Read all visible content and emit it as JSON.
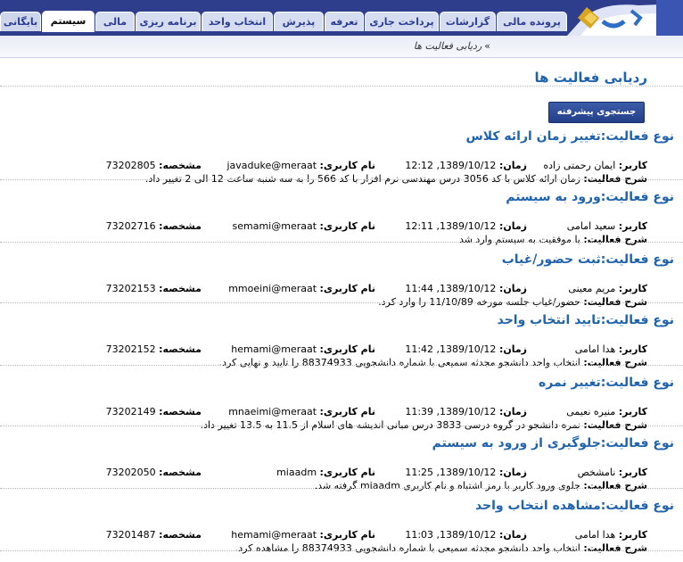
{
  "tabs": [
    {
      "label": "پرونده مالی"
    },
    {
      "label": "گزارشات"
    },
    {
      "label": "پرداخت جاری"
    },
    {
      "label": "تعرفه"
    },
    {
      "label": "پذیرش"
    },
    {
      "label": "انتخاب واحد"
    },
    {
      "label": "برنامه ریزی"
    },
    {
      "label": "مالی"
    },
    {
      "label": "سیستم"
    },
    {
      "label": "بایگانی"
    }
  ],
  "active_tab": "سیستم",
  "breadcrumb": {
    "sep": "»",
    "text": "ردیابی فعالیت ها"
  },
  "page_title": "ردیابی فعالیت ها",
  "advanced_search_label": "جستجوی پیشرفته",
  "labels": {
    "type": "نوع فعالیت:",
    "user": "کاربر:",
    "time": "زمان:",
    "username": "نام کاربری:",
    "id": "مشخصه:",
    "desc": "شرح فعالیت:"
  },
  "activities": [
    {
      "type": "تغییر زمان ارائه کلاس",
      "user": "ایمان رحمتی زاده",
      "time": "1389/10/12, 12:12",
      "username": "javaduke@meraat",
      "id": "73202805",
      "desc": "زمان ارائه کلاس با کد 3056 درس مهندسی نرم افزار با کد 566 را به سه شنبه ساعت 12 الی 2 تغییر داد."
    },
    {
      "type": "ورود به سیستم",
      "user": "سعید امامی",
      "time": "1389/10/12, 12:11",
      "username": "semami@meraat",
      "id": "73202716",
      "desc": "با موفقیت به سیستم وارد شد"
    },
    {
      "type": "ثبت حضور/غیاب",
      "user": "مریم معینی",
      "time": "1389/10/12, 11:44",
      "username": "mmoeini@meraat",
      "id": "73202153",
      "desc": "حضور/غیاب جلسه مورخه 11/10/89 را وارد کرد."
    },
    {
      "type": "تایید انتخاب واحد",
      "user": "هدا امامی",
      "time": "1389/10/12, 11:42",
      "username": "hemami@meraat",
      "id": "73202152",
      "desc": "انتخاب واحد دانشجو مجدثه سمیعی با شماره دانشجویی 88374933 را تایید و نهایی کرد."
    },
    {
      "type": "تغییر نمره",
      "user": "منیره نعیمی",
      "time": "1389/10/12, 11:39",
      "username": "mnaeimi@meraat",
      "id": "73202149",
      "desc": "نمره دانشجو در گروه درسی 3833 درس مبانی اندیشه های اسلام از 11.5 به 13.5 تغییر داد."
    },
    {
      "type": "جلوگیری از ورود به سیستم",
      "user": "نامشخص",
      "time": "1389/10/12, 11:25",
      "username": "miaadm",
      "id": "73202050",
      "desc": "جلوی ورود کاربر با رمز اشتباه و نام کاربری miaadm گرفته شد."
    },
    {
      "type": "مشاهده انتخاب واحد",
      "user": "هدا امامی",
      "time": "1389/10/12, 11:03",
      "username": "hemami@meraat",
      "id": "73201487",
      "desc": "انتخاب واحد دانشجو مجدثه سمیعی با شماره دانشجویی 88374933 را مشاهده کرد."
    }
  ]
}
